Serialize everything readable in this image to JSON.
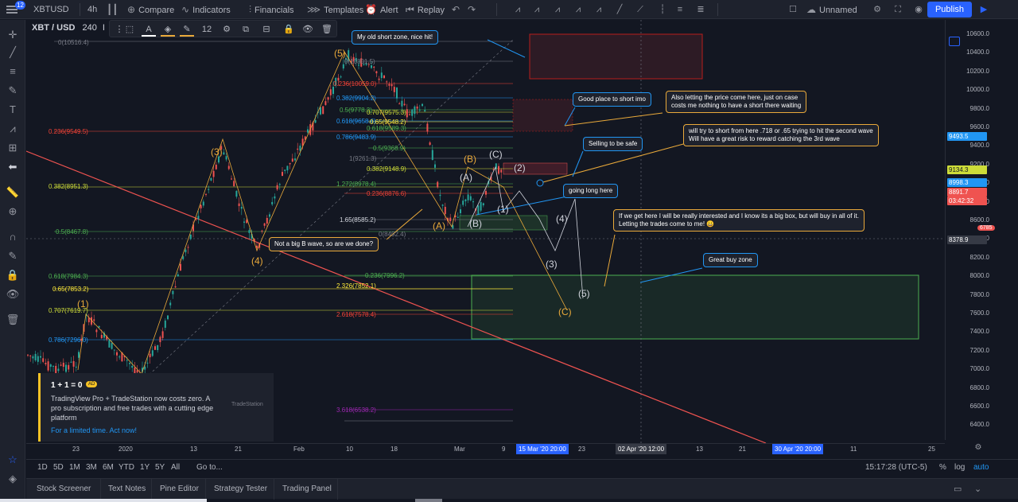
{
  "topbar": {
    "notifications": "12",
    "symbol": "XBTUSD",
    "interval": "4h",
    "compare": "Compare",
    "indicators": "Indicators",
    "financials": "Financials",
    "templates": "Templates",
    "alert": "Alert",
    "replay": "Replay",
    "layout_name": "Unnamed",
    "publish": "Publish"
  },
  "legend": {
    "symbol": "XBT / USD",
    "interval": "240",
    "extra": "I"
  },
  "drawing_toolbar": {
    "font_size": "12"
  },
  "price_axis": {
    "labels": [
      "10600.0",
      "10400.0",
      "10200.0",
      "10000.0",
      "9800.0",
      "9600.0",
      "9400.0",
      "9200.0",
      "9000.0",
      "8800.0",
      "8600.0",
      "8400.0",
      "8200.0",
      "8000.0",
      "7800.0",
      "7600.0",
      "7400.0",
      "7200.0",
      "7000.0",
      "6800.0",
      "6600.0",
      "6400.0"
    ],
    "tags": [
      {
        "text": "9493.5",
        "color": "#2196f3"
      },
      {
        "text": "9134.3",
        "color": "#cddc39"
      },
      {
        "text": "8998.3",
        "color": "#2196f3"
      },
      {
        "text": "8891.7",
        "color": "#ef5350"
      },
      {
        "text": "03:42:32",
        "color": "#ef5350"
      },
      {
        "text": "8378.9",
        "color": "#363a45"
      }
    ],
    "side_badge": "6785"
  },
  "time_axis": {
    "labels": [
      "23",
      "2020",
      "13",
      "21",
      "Feb",
      "10",
      "18",
      "Mar",
      "9",
      "23",
      "13",
      "21",
      "11",
      "25"
    ],
    "tags": [
      "15 Mar '20   20:00",
      "02 Apr '20   12:00",
      "30 Apr '20   20:00"
    ]
  },
  "range_bar": {
    "ranges": [
      "1D",
      "5D",
      "1M",
      "3M",
      "6M",
      "YTD",
      "1Y",
      "5Y",
      "All"
    ],
    "goto": "Go to...",
    "clock": "15:17:28 (UTC-5)",
    "percent": "%",
    "log": "log",
    "auto": "auto"
  },
  "bottom_tabs": [
    "Stock Screener",
    "Text Notes",
    "Pine Editor",
    "Strategy Tester",
    "Trading Panel"
  ],
  "callouts": {
    "old_short": "My old short zone, nice hit!",
    "good_place": "Good place to short imo",
    "also_letting_1": "Also letting the price come here, just on case",
    "also_letting_2": "costs me nothing to have a short there waiting",
    "will_try_1": "will try to short from here .718 or .65 trying to hit the second wave",
    "will_try_2": "Will have a great risk to reward catching the 3rd wave",
    "selling": "Selling to be safe",
    "going_long": "going long here",
    "big_box_1": "If we get here I will be really interested and I know its a big box, but will buy in all of it.",
    "big_box_2": "Letting the trades come to me! 😀",
    "great_buy": "Great buy zone",
    "not_big_b": "Not a big B wave, so are we done?"
  },
  "promo": {
    "title": "1 + 1 = 0",
    "tag": "AD",
    "body": "TradingView Pro + TradeStation now costs zero. A pro subscription and free trades with a cutting edge platform",
    "link": "For a limited time. Act now!",
    "logo": "TradeStation"
  },
  "chart_labels": {
    "waves_gold": [
      "(5)",
      "(3)",
      "(4)",
      "(1)",
      "(A)",
      "(B)",
      "(C)"
    ],
    "waves_white": [
      "(A)",
      "(B)",
      "(C)",
      "(2)",
      "(1)",
      "(4)",
      "(3)",
      "(5)"
    ],
    "fib_left": [
      "0(10516.4)",
      "0.236(9549.5)",
      "0.382(8951.3)",
      "0.5(8467.8)",
      "0.618(7984.3)",
      "0.65(7853.2)",
      "0.707(7619.7)",
      "0.786(7296.0)"
    ],
    "fib_mid": [
      "0(10301.5)",
      "0.236(10059.0)",
      "0.382(9904.2)",
      "0.5(9778.3)",
      "0.618(9658.6)",
      "0.707(9575.3)",
      "0.65(9548.2)",
      "0.618(9589.3)",
      "0.786(9483.9)",
      "0.5(9368.9)",
      "1(9261.3)",
      "0.382(9148.9)",
      "1.272(8978.4)",
      "0.236(8876.6)",
      "1.65(8585.2)",
      "0(8492.4)",
      "0.236(7996.2)",
      "2.326(7852.1)",
      "2.618(7578.4)",
      "3.618(6538.2)"
    ]
  }
}
